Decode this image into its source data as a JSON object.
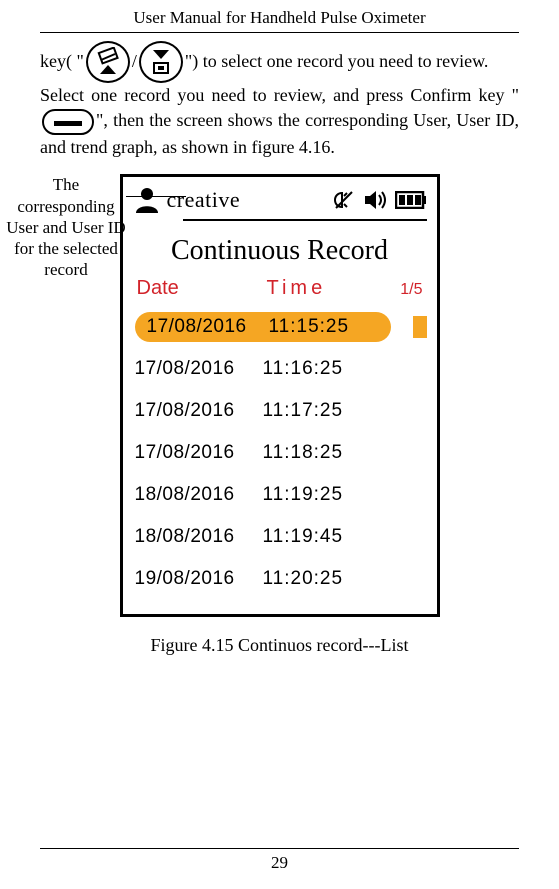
{
  "header": {
    "title": "User Manual for Handheld Pulse Oximeter"
  },
  "text": {
    "pre_key": "key( \"",
    "slash": "/",
    "post_key": "\") to select one record you need to review.",
    "line2a": "Select one record you need to review, and press Confirm key \"",
    "line2b": "\", then the screen shows the corresponding User, User ID, and trend graph, as shown in figure 4.16."
  },
  "annotation": "The corresponding User and User ID for the selected record",
  "device": {
    "logo": "creative",
    "title": "Continuous Record",
    "columns": {
      "date": "Date",
      "time": "Time",
      "page": "1/5"
    },
    "rows": [
      {
        "date": "17/08/2016",
        "time": "11:15:25",
        "selected": true
      },
      {
        "date": "17/08/2016",
        "time": "11:16:25",
        "selected": false
      },
      {
        "date": "17/08/2016",
        "time": "11:17:25",
        "selected": false
      },
      {
        "date": "17/08/2016",
        "time": "11:18:25",
        "selected": false
      },
      {
        "date": "18/08/2016",
        "time": "11:19:25",
        "selected": false
      },
      {
        "date": "18/08/2016",
        "time": "11:19:45",
        "selected": false
      },
      {
        "date": "19/08/2016",
        "time": "11:20:25",
        "selected": false
      }
    ]
  },
  "caption": "Figure 4.15 Continuos record---List",
  "page_number": "29"
}
